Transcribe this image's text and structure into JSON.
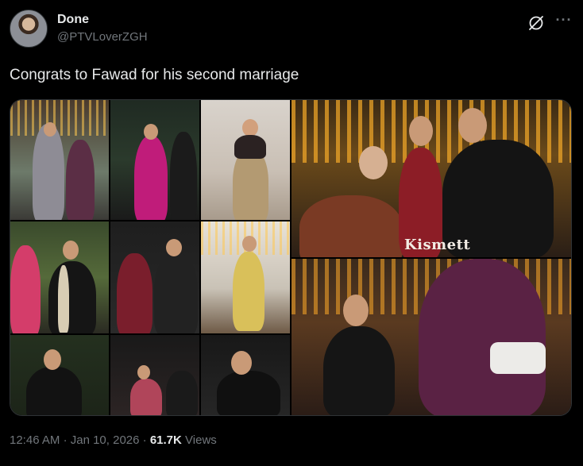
{
  "author": {
    "display_name": "Done",
    "handle": "@PTVLoverZGH",
    "avatar_icon": "avatar-photo"
  },
  "tweet": {
    "text": "Congrats to Fawad for his second marriage"
  },
  "media": {
    "watermark": "Kismett"
  },
  "footer": {
    "time": "12:46 AM",
    "separator": "·",
    "date": "Jan 10, 2026",
    "views_count": "61.7K",
    "views_label": "Views"
  },
  "actions": {
    "grok_icon": "grok-icon",
    "more_icon": "more-icon",
    "more_glyph": "···"
  }
}
